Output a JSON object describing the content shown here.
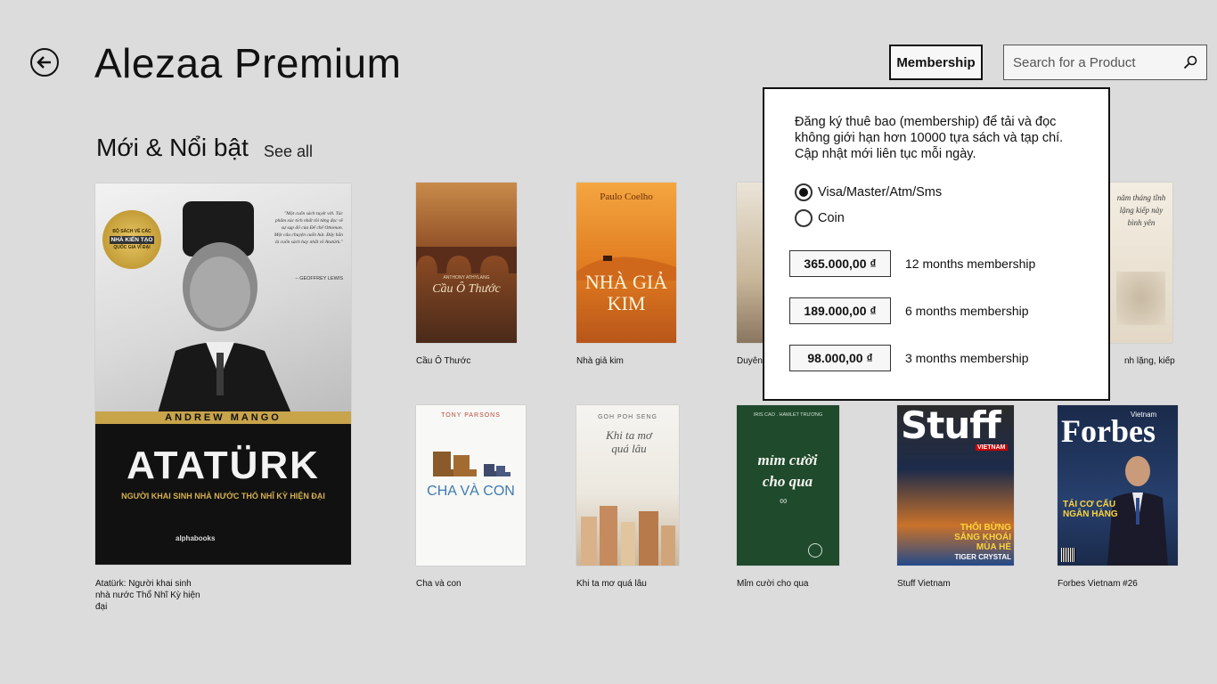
{
  "header": {
    "title": "Alezaa Premium",
    "membership_label": "Membership",
    "search_placeholder": "Search for a Product"
  },
  "section": {
    "title": "Mới & Nổi bật",
    "see_all": "See all"
  },
  "featured": {
    "caption": "Atatürk: Người khai sinh nhà nước Thổ Nhĩ Kỳ hiện đại",
    "cover": {
      "badge_line1": "BỘ SÁCH VỀ CÁC",
      "badge_line2": "NHÀ KIẾN TẠO",
      "badge_line3": "QUỐC GIA VĨ ĐẠI",
      "quote": "\"Một cuốn sách tuyệt vời. Tác phẩm xúc tích nhất tôi từng đọc về sự sụp đổ của Đế chế Ottoman. Một câu chuyện cuốn hút. Đây hẳn là cuốn sách hay nhất về Atatürk.\"",
      "quote_author": "– GEOFFREY LEWIS",
      "author": "ANDREW MANGO",
      "title": "ATATÜRK",
      "subtitle": "NGƯỜI KHAI SINH NHÀ NƯỚC THỔ NHĨ KỲ HIỆN ĐẠI",
      "publisher": "alphabooks"
    }
  },
  "books_row1": [
    {
      "caption": "Cầu Ô Thước",
      "cover_title": "Cầu Ô Thước",
      "cover_author": "ANTHONY ATHYLANG"
    },
    {
      "caption": "Nhà giả kim",
      "cover_title": "NHÀ GIẢ KIM",
      "cover_author": "Paulo Coelho"
    },
    {
      "caption": "Duyên"
    },
    {
      "caption": "nh lặng, kiếp",
      "cover_title": "năm tháng tĩnh lặng kiếp này bình yên"
    }
  ],
  "books_row2": [
    {
      "caption": "Cha và con",
      "cover_title": "CHA VÀ CON",
      "cover_author": "TONY PARSONS"
    },
    {
      "caption": "Khi ta mơ quá lâu",
      "cover_title": "Khi ta mơ quá lâu",
      "cover_author": "GOH POH SENG"
    },
    {
      "caption": "Mỉm cười cho qua",
      "cover_title": "mỉm cười cho qua",
      "cover_author": "IRIS CAO . HAMLET TRƯƠNG"
    },
    {
      "caption": "Stuff Vietnam",
      "cover_title": "Stuff",
      "cover_sub": "VIETNAM",
      "cover_headline": "THỔI BỪNG SẢNG KHOÁI MÙA HÈ",
      "cover_tag": "TIGER CRYSTAL"
    },
    {
      "caption": "Forbes Vietnam #26",
      "cover_title": "Forbes",
      "cover_sub": "Vietnam",
      "cover_headline": "TÁI CƠ CẤU NGÂN HÀNG"
    }
  ],
  "popup": {
    "description": "Đăng ký thuê bao (membership) để tải và đọc không giới hạn hơn 10000 tựa sách và tạp chí. Cập nhật mới liên tục mỗi ngày.",
    "payment_options": [
      "Visa/Master/Atm/Sms",
      "Coin"
    ],
    "selected_payment": "Visa/Master/Atm/Sms",
    "plans": [
      {
        "price": "365.000,00 ₫",
        "label": "12 months membership"
      },
      {
        "price": "189.000,00 ₫",
        "label": "6 months membership"
      },
      {
        "price": "98.000,00 ₫",
        "label": "3 months membership"
      }
    ]
  },
  "colors": {
    "background": "#dcdcdc",
    "popup_bg": "#ffffff",
    "text": "#111111"
  }
}
